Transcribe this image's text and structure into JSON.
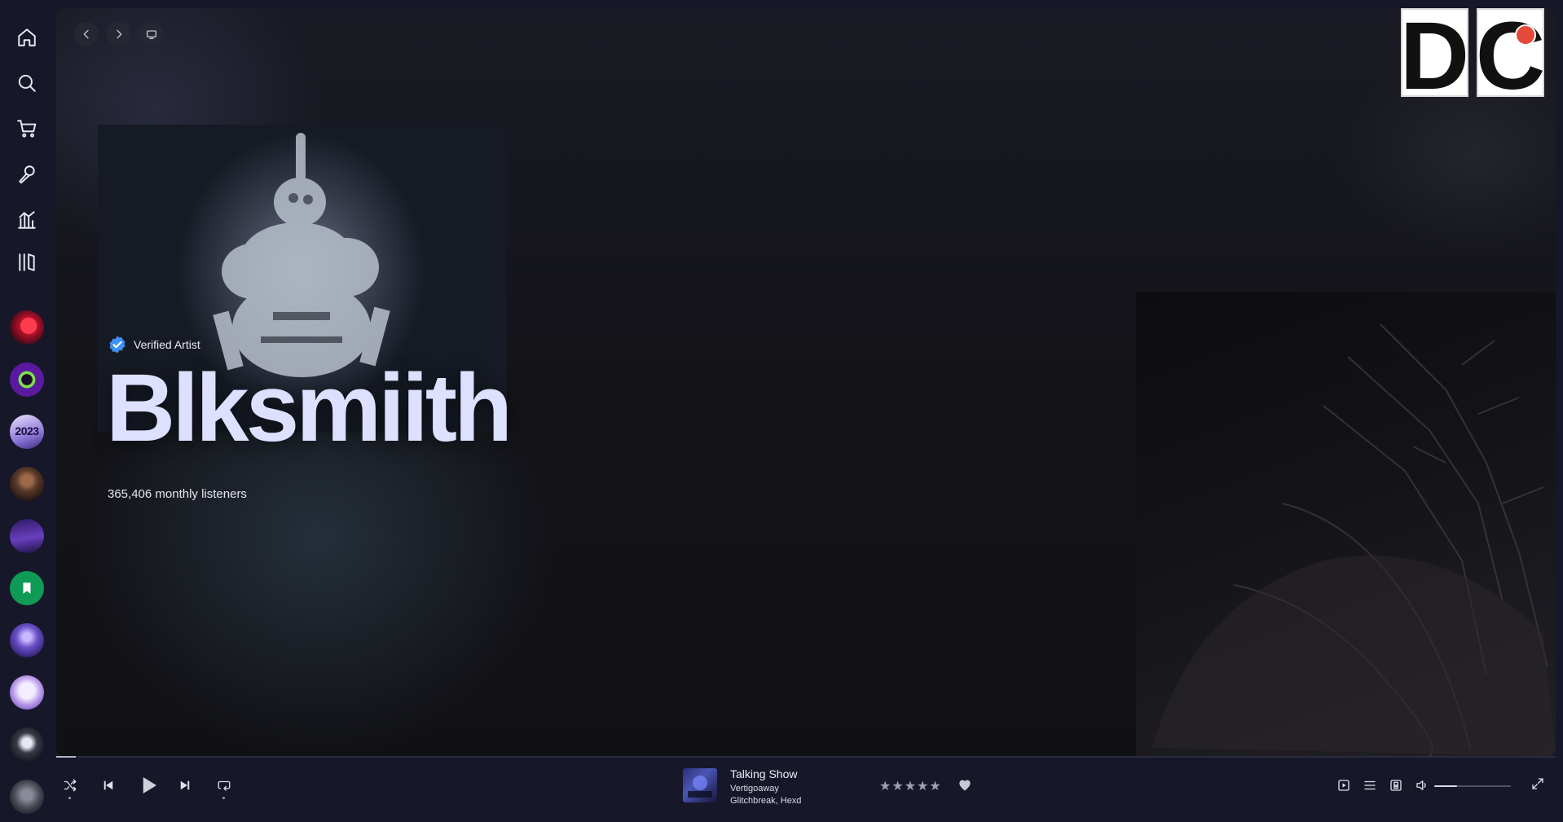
{
  "sidebar": {
    "nav": [
      {
        "name": "home-icon"
      },
      {
        "name": "search-icon"
      },
      {
        "name": "cart-icon"
      },
      {
        "name": "microphone-icon"
      },
      {
        "name": "stats-icon"
      },
      {
        "name": "library-icon"
      }
    ],
    "playlists": [
      {
        "name": "playlist-red"
      },
      {
        "name": "playlist-purple-ring"
      },
      {
        "name": "playlist-2023",
        "label": "2023"
      },
      {
        "name": "playlist-warrior"
      },
      {
        "name": "playlist-purple-scene"
      },
      {
        "name": "playlist-saved-bookmark"
      },
      {
        "name": "playlist-hooded-figure"
      },
      {
        "name": "playlist-anime"
      },
      {
        "name": "playlist-dark-figure"
      },
      {
        "name": "playlist-grey"
      }
    ]
  },
  "header": {
    "profile_letters": [
      "D",
      "C"
    ]
  },
  "artist": {
    "verified_label": "Verified Artist",
    "name": "Blksmiith",
    "monthly_listeners": "365,406 monthly listeners"
  },
  "player": {
    "progress_fraction": 0.013,
    "now_playing": {
      "title": "Talking Show",
      "album": "Vertigoaway",
      "artists": "Glitchbreak, Hexd"
    },
    "rating_stars": 5,
    "volume_fraction": 0.3
  },
  "colors": {
    "accent_verified": "#3d91f4",
    "artist_name": "#dde0ff",
    "sidebar_bg": "#17172a"
  }
}
